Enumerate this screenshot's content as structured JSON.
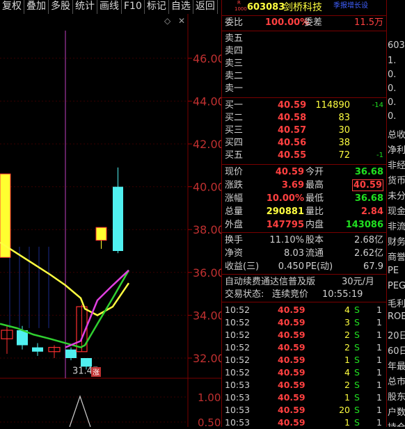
{
  "toolbar": {
    "items": [
      "复权",
      "叠加",
      "多股",
      "统计",
      "画线",
      "F10",
      "标记",
      "自选",
      "返回"
    ]
  },
  "chart": {
    "price_ticks": [
      "46.00",
      "44.00",
      "42.00",
      "40.00",
      "38.00",
      "36.00",
      "34.00",
      "32.00"
    ],
    "vol_ticks": [
      "1.00",
      "0.50"
    ],
    "low_label": "31.47",
    "limit_badge": "涨",
    "diamond": "◇",
    "close_x": "✕"
  },
  "chart_data": {
    "type": "candlestick",
    "y_axis_ticks": [
      46,
      44,
      42,
      40,
      38,
      36,
      34,
      32
    ],
    "candles": [
      {
        "open": 32.9,
        "close": 33.3,
        "high": 33.5,
        "low": 32.2,
        "color": "red"
      },
      {
        "open": 33.3,
        "close": 32.6,
        "high": 33.5,
        "low": 32.4,
        "color": "cyan"
      },
      {
        "open": 32.5,
        "close": 32.3,
        "high": 32.7,
        "low": 32.1,
        "color": "cyan"
      },
      {
        "open": 32.3,
        "close": 32.5,
        "high": 32.6,
        "low": 32.0,
        "color": "red"
      },
      {
        "open": 32.4,
        "close": 32.0,
        "high": 32.5,
        "low": 31.9,
        "color": "cyan"
      },
      {
        "open": 32.0,
        "close": 31.6,
        "high": 32.0,
        "low": 31.47,
        "color": "cyan"
      },
      {
        "open": 32.3,
        "close": 34.4,
        "high": 34.5,
        "low": 32.3,
        "color": "red"
      },
      {
        "open": 37.5,
        "close": 38.1,
        "high": 38.1,
        "low": 37.1,
        "color": "yellow"
      },
      {
        "open": 37.0,
        "close": 40.0,
        "high": 40.9,
        "low": 36.9,
        "color": "cyan"
      },
      {
        "open": 40.6,
        "close": 36.7,
        "high": 40.6,
        "low": 36.7,
        "color": "yellow"
      }
    ],
    "series": [
      {
        "name": "",
        "color": "#ffff40",
        "values": [
          37.4,
          36.9,
          36.4,
          35.9,
          35.4,
          34.8,
          34.3,
          34.0,
          34.4,
          35.5
        ]
      },
      {
        "name": "",
        "color": "#30d030",
        "values": [
          33.6,
          33.4,
          33.1,
          32.9,
          32.7,
          32.5,
          32.6,
          33.6,
          34.8,
          36.1
        ]
      }
    ]
  },
  "quote": {
    "r_badge": "R",
    "code_num": "1000",
    "code": "603083",
    "name": "剑桥科技",
    "tag": "季报增长设",
    "weibi_label": "委比",
    "weibi_value": "100.00%",
    "weicha_label": "委差",
    "weicha_value": "11.5万",
    "sell": [
      {
        "label": "卖五"
      },
      {
        "label": "卖四"
      },
      {
        "label": "卖三"
      },
      {
        "label": "卖二"
      },
      {
        "label": "卖一"
      }
    ],
    "buy": [
      {
        "label": "买一",
        "price": "40.59",
        "vol": "114890",
        "chg": "-14"
      },
      {
        "label": "买二",
        "price": "40.58",
        "vol": "83",
        "chg": ""
      },
      {
        "label": "买三",
        "price": "40.57",
        "vol": "30",
        "chg": ""
      },
      {
        "label": "买四",
        "price": "40.56",
        "vol": "38",
        "chg": ""
      },
      {
        "label": "买五",
        "price": "40.55",
        "vol": "72",
        "chg": "-1"
      }
    ],
    "stats": [
      {
        "l1": "现价",
        "v1": "40.59",
        "c1": "r",
        "l2": "今开",
        "v2": "36.68",
        "c2": "g"
      },
      {
        "l1": "涨跌",
        "v1": "3.69",
        "c1": "r",
        "l2": "最高",
        "v2": "40.59",
        "c2": "r"
      },
      {
        "l1": "涨幅",
        "v1": "10.00%",
        "c1": "r",
        "l2": "最低",
        "v2": "36.68",
        "c2": "g"
      },
      {
        "l1": "总量",
        "v1": "290881",
        "c1": "y",
        "l2": "量比",
        "v2": "2.84",
        "c2": "r"
      },
      {
        "l1": "外盘",
        "v1": "147795",
        "c1": "r",
        "l2": "内盘",
        "v2": "143086",
        "c2": "g"
      }
    ],
    "stats2": [
      {
        "l1": "换手",
        "v1": "11.10%",
        "l2": "股本",
        "v2": "2.68亿"
      },
      {
        "l1": "净资",
        "v1": "8.03",
        "l2": "流通",
        "v2": "2.62亿"
      },
      {
        "l1": "收益(三)",
        "v1": "0.450",
        "l2": "PE(动)",
        "v2": "67.9"
      }
    ],
    "ad_text": "自动续费通达信普及版",
    "ad_price": "30元/月",
    "status_label": "交易状态:",
    "status_value": "连续竞价",
    "status_time": "10:55:19",
    "ticks": [
      {
        "t": "10:52",
        "p": "40.59",
        "v": "4",
        "s": "S",
        "n": "1"
      },
      {
        "t": "10:52",
        "p": "40.59",
        "v": "3",
        "s": "S",
        "n": "1"
      },
      {
        "t": "10:52",
        "p": "40.59",
        "v": "2",
        "s": "S",
        "n": "1"
      },
      {
        "t": "10:52",
        "p": "40.59",
        "v": "2",
        "s": "S",
        "n": "1"
      },
      {
        "t": "10:52",
        "p": "40.59",
        "v": "1",
        "s": "S",
        "n": "1"
      },
      {
        "t": "10:52",
        "p": "40.59",
        "v": "4",
        "s": "S",
        "n": "1"
      },
      {
        "t": "10:53",
        "p": "40.59",
        "v": "2",
        "s": "S",
        "n": "1"
      },
      {
        "t": "10:53",
        "p": "40.59",
        "v": "1",
        "s": "S",
        "n": "1"
      },
      {
        "t": "10:53",
        "p": "40.59",
        "v": "20",
        "s": "S",
        "n": "1"
      },
      {
        "t": "10:53",
        "p": "40.59",
        "v": "1",
        "s": "S",
        "n": "1"
      }
    ]
  },
  "far": {
    "lines": [
      "603",
      "1.",
      "0.",
      "0.",
      "0.",
      "0.",
      "总收",
      "净利",
      "非经",
      "货币",
      "未分",
      "现金",
      "非流",
      "财务",
      "商誉",
      "PE",
      "PEG",
      "毛利",
      "ROE",
      "20日",
      "60日",
      "年最",
      "总市",
      "股东",
      "户数",
      "持仓"
    ]
  }
}
